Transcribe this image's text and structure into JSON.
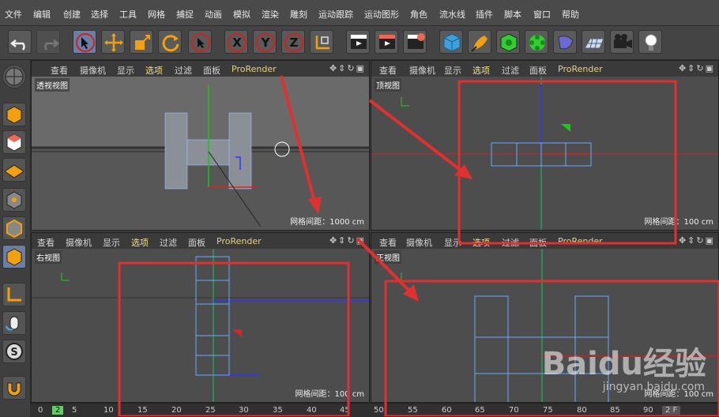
{
  "menu": [
    "文件",
    "编辑",
    "创建",
    "选择",
    "工具",
    "网格",
    "捕捉",
    "动画",
    "模拟",
    "渲染",
    "雕刻",
    "运动跟踪",
    "运动图形",
    "角色",
    "流水线",
    "插件",
    "脚本",
    "窗口",
    "帮助"
  ],
  "viewport_menu": {
    "view": "查看",
    "camera": "摄像机",
    "display": "显示",
    "options": "选项",
    "filter": "过滤",
    "panel": "面板",
    "prorender": "ProRender"
  },
  "viewports": {
    "perspective": {
      "label": "透视视图",
      "grid": "网格间距：1000 cm"
    },
    "top": {
      "label": "顶视图",
      "grid": "网格间距：100 cm"
    },
    "right": {
      "label": "右视图",
      "grid": "网格间距：100 cm"
    },
    "front": {
      "label": "正视图",
      "grid": "网格间距：100 cm"
    }
  },
  "timeline": {
    "ticks": [
      "0",
      "2",
      "5",
      "10",
      "15",
      "20",
      "25",
      "30",
      "35",
      "40",
      "45",
      "50",
      "55",
      "60",
      "65",
      "70",
      "75",
      "80",
      "85",
      "90"
    ],
    "end": "2 F"
  },
  "axis_labels": {
    "y": "Y",
    "x": "X",
    "z": "Z"
  },
  "watermark": {
    "brand": "Baidu经验",
    "url": "jingyan.baidu.com"
  },
  "colors": {
    "highlight": "#e03030",
    "accent": "#6b7fa6"
  }
}
